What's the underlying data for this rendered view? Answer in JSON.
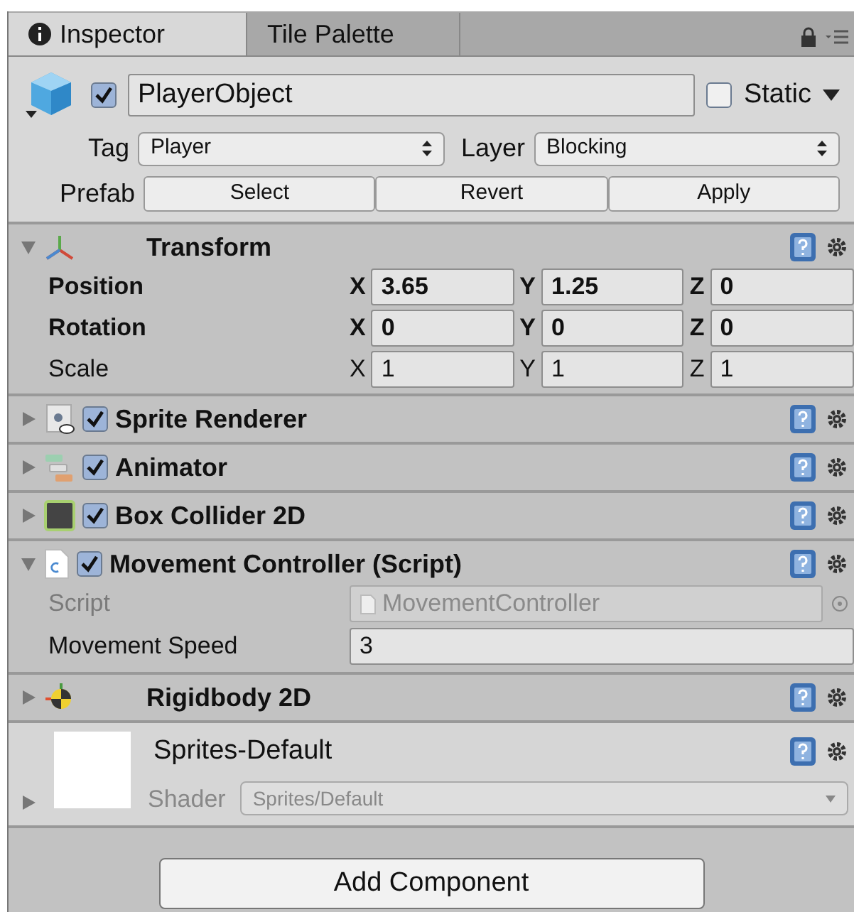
{
  "tabs": [
    {
      "label": "Inspector",
      "selected": true,
      "kind": "info"
    },
    {
      "label": "Tile Palette",
      "selected": false,
      "kind": "plain"
    }
  ],
  "object": {
    "active": true,
    "name": "PlayerObject",
    "static": {
      "label": "Static",
      "checked": false
    },
    "tag": {
      "label": "Tag",
      "value": "Player"
    },
    "layer": {
      "label": "Layer",
      "value": "Blocking"
    },
    "prefab": {
      "label": "Prefab",
      "buttons": [
        "Select",
        "Revert",
        "Apply"
      ]
    }
  },
  "components": [
    {
      "kind": "transform",
      "name": "Transform",
      "expanded": true,
      "rows": [
        {
          "label": "Position",
          "bold": true,
          "fields": [
            {
              "axis": "X",
              "value": "3.65"
            },
            {
              "axis": "Y",
              "value": "1.25"
            },
            {
              "axis": "Z",
              "value": "0"
            }
          ]
        },
        {
          "label": "Rotation",
          "bold": true,
          "fields": [
            {
              "axis": "X",
              "value": "0"
            },
            {
              "axis": "Y",
              "value": "0"
            },
            {
              "axis": "Z",
              "value": "0"
            }
          ]
        },
        {
          "label": "Scale",
          "bold": false,
          "fields": [
            {
              "axis": "X",
              "value": "1"
            },
            {
              "axis": "Y",
              "value": "1"
            },
            {
              "axis": "Z",
              "value": "1"
            }
          ]
        }
      ]
    },
    {
      "kind": "sprite",
      "name": "Sprite Renderer",
      "enabled": true,
      "expanded": false
    },
    {
      "kind": "animator",
      "name": "Animator",
      "enabled": true,
      "expanded": false
    },
    {
      "kind": "collider",
      "name": "Box Collider 2D",
      "enabled": true,
      "expanded": false
    },
    {
      "kind": "script",
      "name": "Movement Controller (Script)",
      "enabled": true,
      "expanded": true,
      "properties": [
        {
          "label": "Script",
          "kind": "object",
          "disabled": true,
          "value": "MovementController"
        },
        {
          "label": "Movement Speed",
          "kind": "number",
          "disabled": false,
          "value": "3"
        }
      ]
    },
    {
      "kind": "rigidbody",
      "name": "Rigidbody 2D",
      "expanded": false
    }
  ],
  "material": {
    "name": "Sprites-Default",
    "expanded": false,
    "shader_label": "Shader",
    "shader_value": "Sprites/Default"
  },
  "add_component": "Add Component"
}
